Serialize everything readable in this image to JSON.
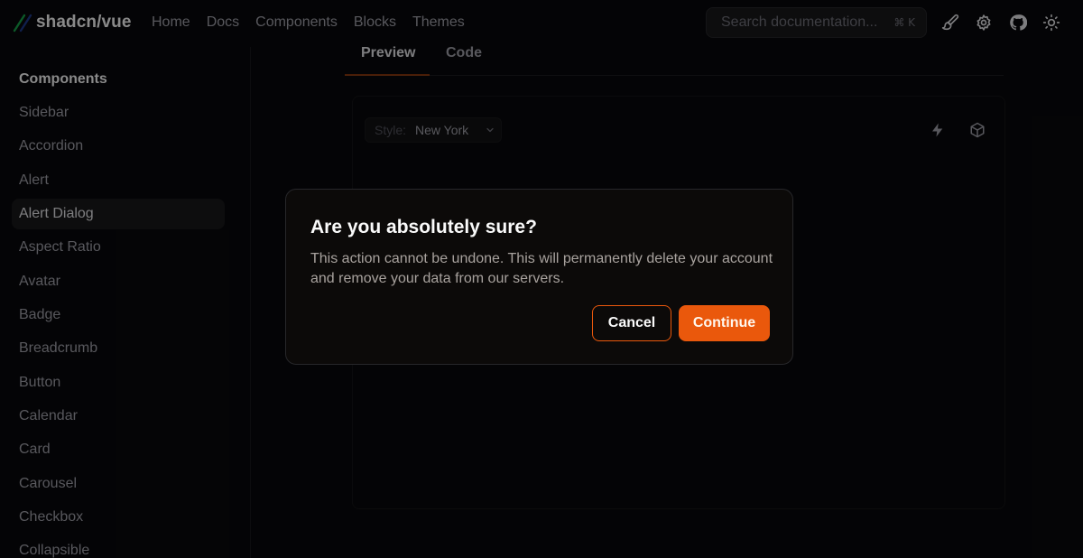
{
  "header": {
    "logo_text": "shadcn/vue",
    "nav": [
      "Home",
      "Docs",
      "Components",
      "Blocks",
      "Themes"
    ],
    "search_placeholder": "Search documentation...",
    "search_shortcut": "⌘ K",
    "icons": [
      "paintbrush-icon",
      "gear-icon",
      "github-icon",
      "sun-icon"
    ]
  },
  "sidebar": {
    "title": "Components",
    "items": [
      {
        "label": "Sidebar"
      },
      {
        "label": "Accordion"
      },
      {
        "label": "Alert"
      },
      {
        "label": "Alert Dialog",
        "active": true
      },
      {
        "label": "Aspect Ratio"
      },
      {
        "label": "Avatar"
      },
      {
        "label": "Badge"
      },
      {
        "label": "Breadcrumb"
      },
      {
        "label": "Button"
      },
      {
        "label": "Calendar"
      },
      {
        "label": "Card"
      },
      {
        "label": "Carousel"
      },
      {
        "label": "Checkbox"
      },
      {
        "label": "Collapsible"
      }
    ]
  },
  "main": {
    "tabs": [
      {
        "label": "Preview",
        "active": true
      },
      {
        "label": "Code"
      }
    ],
    "style_label": "Style:",
    "style_value": "New York",
    "toolbar_icons": [
      "zap-icon",
      "box-icon"
    ]
  },
  "dialog": {
    "title": "Are you absolutely sure?",
    "description": "This action cannot be undone. This will permanently delete your account and remove your data from our servers.",
    "cancel_label": "Cancel",
    "continue_label": "Continue"
  },
  "colors": {
    "background": "#09090b",
    "accent": "#ea580c",
    "muted_text": "#a1a1aa"
  }
}
